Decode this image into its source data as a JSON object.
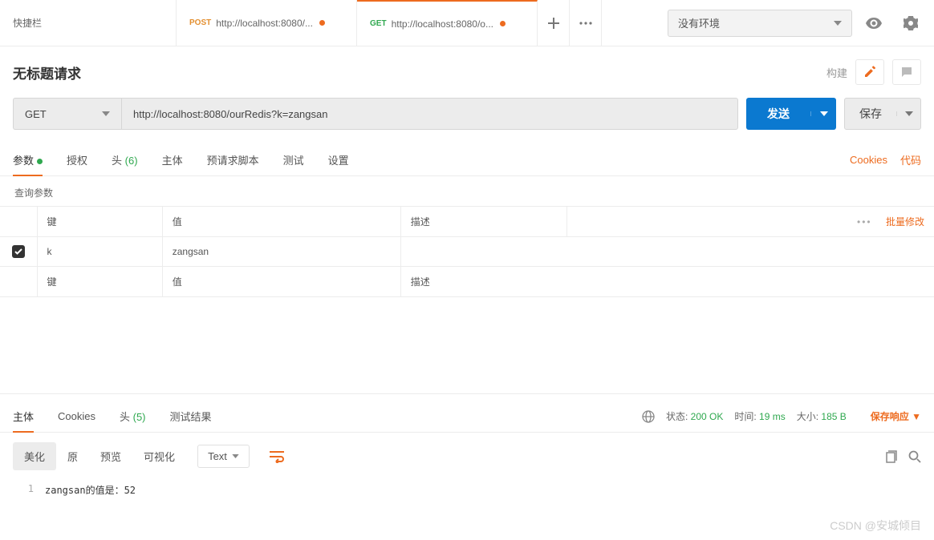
{
  "tabs": {
    "quick": "快捷栏",
    "t1": {
      "method": "POST",
      "label": "http://localhost:8080/..."
    },
    "t2": {
      "method": "GET",
      "label": "http://localhost:8080/o..."
    }
  },
  "env": {
    "label": "没有环境"
  },
  "title": "无标题请求",
  "title_actions": {
    "build": "构建"
  },
  "request": {
    "method": "GET",
    "url": "http://localhost:8080/ourRedis?k=zangsan",
    "send": "发送",
    "save": "保存"
  },
  "req_tabs": {
    "params": "参数",
    "auth": "授权",
    "headers": "头",
    "headers_count": "(6)",
    "body": "主体",
    "prereq": "预请求脚本",
    "tests": "测试",
    "settings": "设置",
    "cookies": "Cookies",
    "code": "代码"
  },
  "params_section": {
    "title": "查询参数",
    "cols": {
      "key": "键",
      "value": "值",
      "desc": "描述"
    },
    "bulk": "批量修改",
    "rows": [
      {
        "key": "k",
        "value": "zangsan",
        "desc": ""
      }
    ],
    "placeholders": {
      "key": "键",
      "value": "值",
      "desc": "描述"
    }
  },
  "resp_tabs": {
    "body": "主体",
    "cookies": "Cookies",
    "headers": "头",
    "headers_count": "(5)",
    "tests": "测试结果"
  },
  "status": {
    "status_label": "状态:",
    "status_value": "200 OK",
    "time_label": "时间:",
    "time_value": "19 ms",
    "size_label": "大小:",
    "size_value": "185 B",
    "save_resp": "保存响应"
  },
  "resp_toolbar": {
    "pretty": "美化",
    "raw": "原",
    "preview": "预览",
    "visual": "可视化",
    "format": "Text"
  },
  "response_body": {
    "line": "1",
    "text": "zangsan的值是：52"
  },
  "watermark": "CSDN @安城倾目"
}
